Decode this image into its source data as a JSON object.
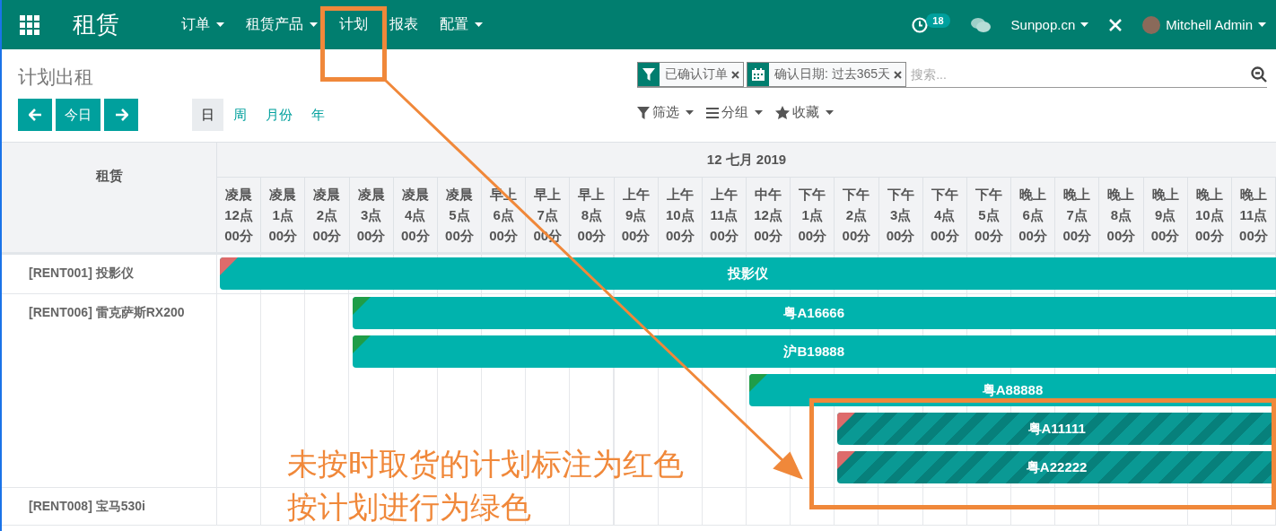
{
  "navbar": {
    "app_title": "租赁",
    "menu": [
      {
        "label": "订单",
        "dropdown": true
      },
      {
        "label": "租赁产品",
        "dropdown": true
      },
      {
        "label": "计划",
        "dropdown": false
      },
      {
        "label": "报表",
        "dropdown": false
      },
      {
        "label": "配置",
        "dropdown": true
      }
    ],
    "activity_count": "18",
    "company": "Sunpop.cn",
    "user": "Mitchell Admin"
  },
  "control_panel": {
    "breadcrumb": "计划出租",
    "today_button": "今日",
    "scales": [
      {
        "label": "日",
        "selected": true
      },
      {
        "label": "周",
        "selected": false
      },
      {
        "label": "月份",
        "selected": false
      },
      {
        "label": "年",
        "selected": false
      }
    ],
    "facets": [
      {
        "kind": "filter",
        "label": "已确认订单"
      },
      {
        "kind": "date",
        "label": "确认日期: 过去365天"
      }
    ],
    "search": {
      "placeholder": "搜索..."
    },
    "search_menus": [
      {
        "kind": "filter",
        "label": "筛选"
      },
      {
        "kind": "groupby",
        "label": "分组"
      },
      {
        "kind": "favorite",
        "label": "收藏"
      }
    ]
  },
  "gantt": {
    "row_header": "租赁",
    "date": "12 七月 2019",
    "columns": [
      {
        "period": "凌晨",
        "hour": "12点",
        "minute": "00分"
      },
      {
        "period": "凌晨",
        "hour": "1点",
        "minute": "00分"
      },
      {
        "period": "凌晨",
        "hour": "2点",
        "minute": "00分"
      },
      {
        "period": "凌晨",
        "hour": "3点",
        "minute": "00分"
      },
      {
        "period": "凌晨",
        "hour": "4点",
        "minute": "00分"
      },
      {
        "period": "凌晨",
        "hour": "5点",
        "minute": "00分"
      },
      {
        "period": "早上",
        "hour": "6点",
        "minute": "00分"
      },
      {
        "period": "早上",
        "hour": "7点",
        "minute": "00分"
      },
      {
        "period": "早上",
        "hour": "8点",
        "minute": "00分"
      },
      {
        "period": "上午",
        "hour": "9点",
        "minute": "00分"
      },
      {
        "period": "上午",
        "hour": "10点",
        "minute": "00分"
      },
      {
        "period": "上午",
        "hour": "11点",
        "minute": "00分"
      },
      {
        "period": "中午",
        "hour": "12点",
        "minute": "00分"
      },
      {
        "period": "下午",
        "hour": "1点",
        "minute": "00分"
      },
      {
        "period": "下午",
        "hour": "2点",
        "minute": "00分"
      },
      {
        "period": "下午",
        "hour": "3点",
        "minute": "00分"
      },
      {
        "period": "下午",
        "hour": "4点",
        "minute": "00分"
      },
      {
        "period": "下午",
        "hour": "5点",
        "minute": "00分"
      },
      {
        "period": "晚上",
        "hour": "6点",
        "minute": "00分"
      },
      {
        "period": "晚上",
        "hour": "7点",
        "minute": "00分"
      },
      {
        "period": "晚上",
        "hour": "8点",
        "minute": "00分"
      },
      {
        "period": "晚上",
        "hour": "9点",
        "minute": "00分"
      },
      {
        "period": "晚上",
        "hour": "10点",
        "minute": "00分"
      },
      {
        "period": "晚上",
        "hour": "11点",
        "minute": "00分"
      }
    ],
    "rows": [
      {
        "label": "[RENT001] 投影仪",
        "pills": [
          {
            "label": "投影仪",
            "level": 1,
            "color": "#de6b6b",
            "striped": false
          }
        ]
      },
      {
        "label": "[RENT006] 雷克萨斯RX200",
        "pills": [
          {
            "label": "粤A16666",
            "level": 0.875,
            "color": "#1f9d48",
            "striped": false
          },
          {
            "label": "沪B19888",
            "level": 0.875,
            "color": "#1f9d48",
            "striped": false
          },
          {
            "label": "粤A88888",
            "level": 0.5,
            "color": "#1f9d48",
            "striped": false
          },
          {
            "label": "粤A11111",
            "level": 0.4167,
            "color": "#de6b6b",
            "striped": true
          },
          {
            "label": "粤A22222",
            "level": 0.4167,
            "color": "#de6b6b",
            "striped": true
          }
        ]
      },
      {
        "label": "[RENT008] 宝马530i",
        "pills": []
      }
    ]
  },
  "annotations": {
    "note_lines": [
      "未按时取货的计划标注为红色",
      "按计划进行为绿色"
    ]
  }
}
